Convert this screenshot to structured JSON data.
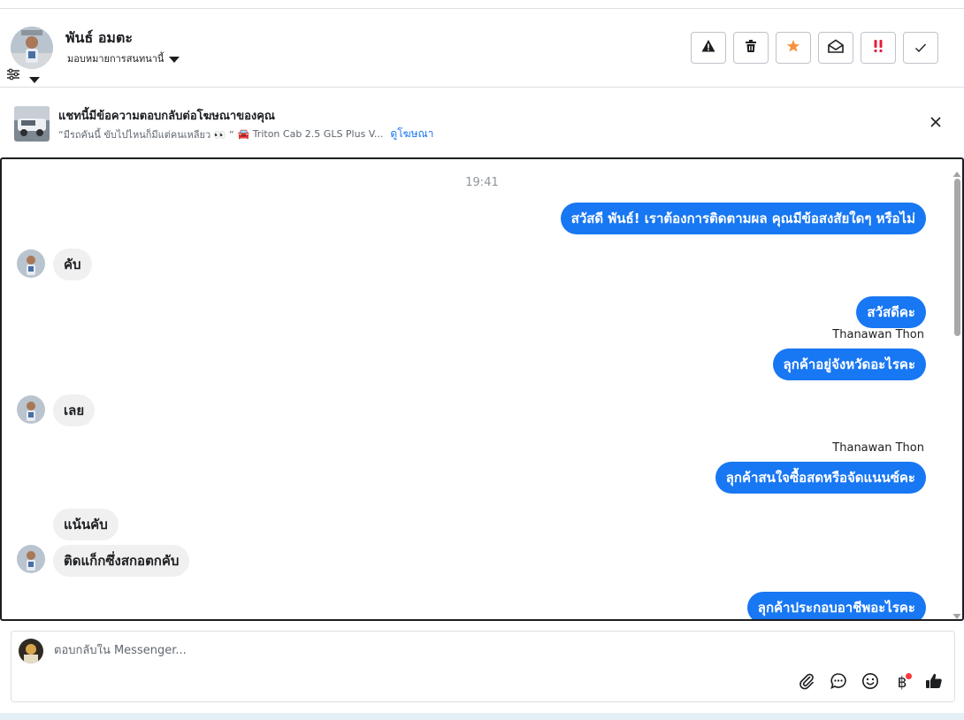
{
  "header": {
    "contact_name": "พันธ์ อมตะ",
    "assign_label": "มอบหมายการสนทนานี้"
  },
  "actions": [
    {
      "name": "report-spam",
      "icon": "warning-icon"
    },
    {
      "name": "delete",
      "icon": "trash-icon"
    },
    {
      "name": "star",
      "icon": "star-icon",
      "color": "#f7923b"
    },
    {
      "name": "mark-unread",
      "icon": "envelope-open-icon"
    },
    {
      "name": "follow-up",
      "icon": "exclamation-icon",
      "color": "#e41e3f"
    },
    {
      "name": "mark-done",
      "icon": "check-icon"
    }
  ],
  "ad_banner": {
    "title": "แชทนี้มีข้อความตอบกลับต่อโฆษณาของคุณ",
    "quote": "“มีรถคันนี้ ขับไปไหนก็มีแต่คนเหลียว 👀 ”",
    "product": "🚘 Triton Cab 2.5 GLS Plus V...",
    "link": "ดูโฆษณา"
  },
  "chat": {
    "timestamp": "19:41",
    "messages": [
      {
        "dir": "out",
        "text": "สวัสดี พันธ์! เราต้องการติดตามผล คุณมีข้อสงสัยใดๆ หรือไม่"
      },
      {
        "dir": "in",
        "text": "คับ"
      },
      {
        "dir": "out",
        "text": "สวัสดีคะ"
      },
      {
        "dir": "sender",
        "text": "Thanawan Thon"
      },
      {
        "dir": "out",
        "text": "ลุกค้าอยู่จังหวัดอะไรคะ"
      },
      {
        "dir": "in",
        "text": "เลย"
      },
      {
        "dir": "sender",
        "text": "Thanawan Thon"
      },
      {
        "dir": "out",
        "text": "ลุกค้าสนใจซื้อสดหรือจัดแนนซ์คะ"
      },
      {
        "dir": "in",
        "text": "แน้นคับ"
      },
      {
        "dir": "in",
        "text": "ติดแก็กซึ่งสกอตกคับ"
      },
      {
        "dir": "out",
        "text": "ลุกค้าประกอบอาชีพอะไรคะ"
      }
    ]
  },
  "composer": {
    "placeholder": "ตอบกลับใน Messenger...",
    "tools": [
      "paperclip-icon",
      "saved-reply-icon",
      "emoji-icon",
      "baht-payment-icon",
      "thumbs-up-icon"
    ],
    "baht_symbol": "฿"
  },
  "colors": {
    "accent": "#1877f2",
    "incoming_bubble": "#f0f0f0",
    "notification_dot": "#fa383e"
  }
}
